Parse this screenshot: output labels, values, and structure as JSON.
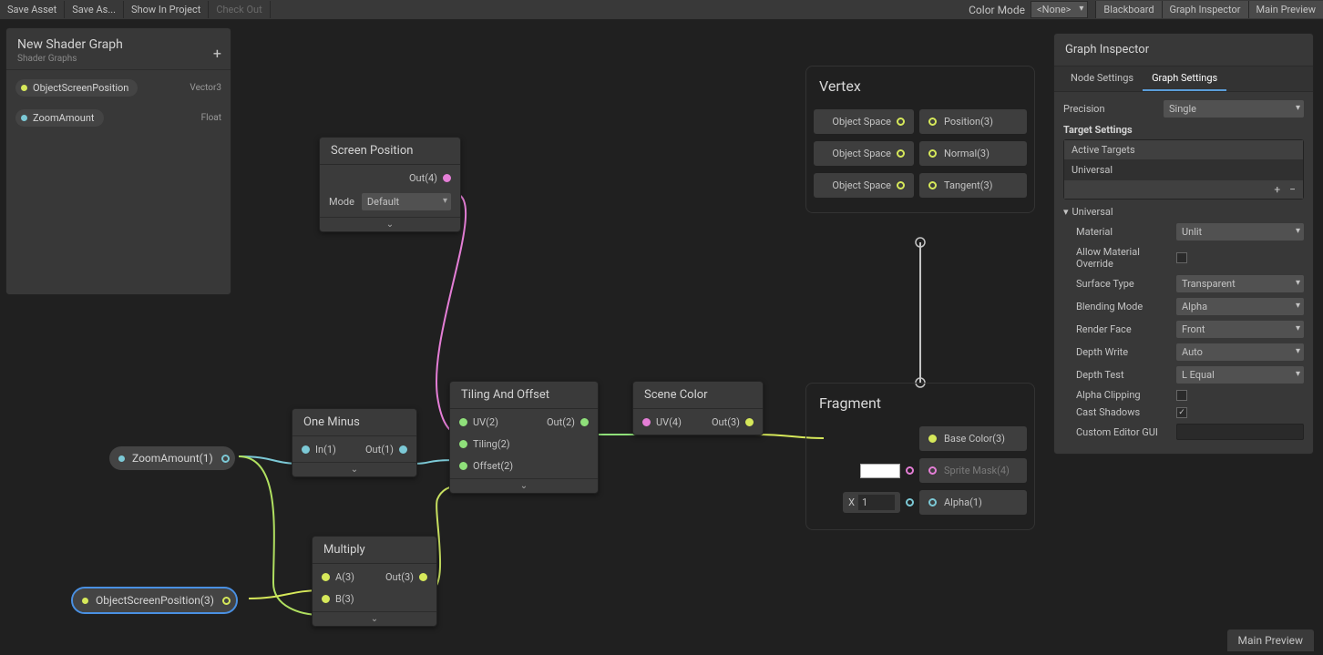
{
  "toolbar": {
    "save_asset": "Save Asset",
    "save_as": "Save As...",
    "show_in_project": "Show In Project",
    "check_out": "Check Out",
    "color_mode_label": "Color Mode",
    "color_mode_value": "<None>",
    "blackboard": "Blackboard",
    "graph_inspector": "Graph Inspector",
    "main_preview": "Main Preview"
  },
  "blackboard": {
    "title": "New Shader Graph",
    "subtitle": "Shader Graphs",
    "properties": [
      {
        "name": "ObjectScreenPosition",
        "type": "Vector3",
        "color": "#d6e85a"
      },
      {
        "name": "ZoomAmount",
        "type": "Float",
        "color": "#7cc9d6"
      }
    ]
  },
  "nodes": {
    "screen_position": {
      "title": "Screen Position",
      "out": "Out(4)",
      "mode_label": "Mode",
      "mode_value": "Default"
    },
    "one_minus": {
      "title": "One Minus",
      "in": "In(1)",
      "out": "Out(1)"
    },
    "multiply": {
      "title": "Multiply",
      "a": "A(3)",
      "b": "B(3)",
      "out": "Out(3)"
    },
    "tiling_offset": {
      "title": "Tiling And Offset",
      "uv": "UV(2)",
      "tiling": "Tiling(2)",
      "offset": "Offset(2)",
      "out": "Out(2)"
    },
    "scene_color": {
      "title": "Scene Color",
      "uv": "UV(4)",
      "out": "Out(3)"
    },
    "zoom_chip": "ZoomAmount(1)",
    "osp_chip": "ObjectScreenPosition(3)"
  },
  "master": {
    "vertex": {
      "title": "Vertex",
      "slots": [
        {
          "left": "Object Space",
          "right": "Position(3)"
        },
        {
          "left": "Object Space",
          "right": "Normal(3)"
        },
        {
          "left": "Object Space",
          "right": "Tangent(3)"
        }
      ]
    },
    "fragment": {
      "title": "Fragment",
      "base_color": "Base Color(3)",
      "sprite_mask": "Sprite Mask(4)",
      "alpha": "Alpha(1)",
      "alpha_x_label": "X",
      "alpha_x_value": "1"
    }
  },
  "inspector": {
    "title": "Graph Inspector",
    "tab_node": "Node Settings",
    "tab_graph": "Graph Settings",
    "precision_label": "Precision",
    "precision_value": "Single",
    "target_settings": "Target Settings",
    "active_targets": "Active Targets",
    "target_item": "Universal",
    "universal_fold": "Universal",
    "rows": {
      "material": {
        "label": "Material",
        "value": "Unlit"
      },
      "allow_override": {
        "label": "Allow Material Override",
        "checked": false
      },
      "surface_type": {
        "label": "Surface Type",
        "value": "Transparent"
      },
      "blending_mode": {
        "label": "Blending Mode",
        "value": "Alpha"
      },
      "render_face": {
        "label": "Render Face",
        "value": "Front"
      },
      "depth_write": {
        "label": "Depth Write",
        "value": "Auto"
      },
      "depth_test": {
        "label": "Depth Test",
        "value": "L Equal"
      },
      "alpha_clipping": {
        "label": "Alpha Clipping",
        "checked": false
      },
      "cast_shadows": {
        "label": "Cast Shadows",
        "checked": true
      },
      "custom_editor": {
        "label": "Custom Editor GUI",
        "value": ""
      }
    }
  },
  "main_preview_footer": "Main Preview"
}
